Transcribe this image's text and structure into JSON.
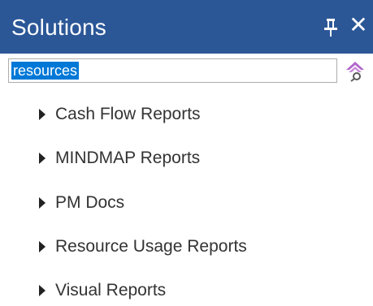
{
  "panel": {
    "title": "Solutions",
    "pin_icon": "pin-icon",
    "close_glyph": "✕"
  },
  "search": {
    "value": "resources",
    "icon": "search-filter-icon",
    "icon_colors": [
      "#b266cc",
      "#7ea4c9",
      "#5a5a5a"
    ]
  },
  "tree": {
    "items": [
      {
        "label": "Cash Flow Reports"
      },
      {
        "label": "MINDMAP Reports"
      },
      {
        "label": "PM Docs"
      },
      {
        "label": "Resource Usage Reports"
      },
      {
        "label": "Visual Reports"
      }
    ]
  },
  "colors": {
    "titlebar": "#2b5797",
    "selection": "#0078d7"
  }
}
